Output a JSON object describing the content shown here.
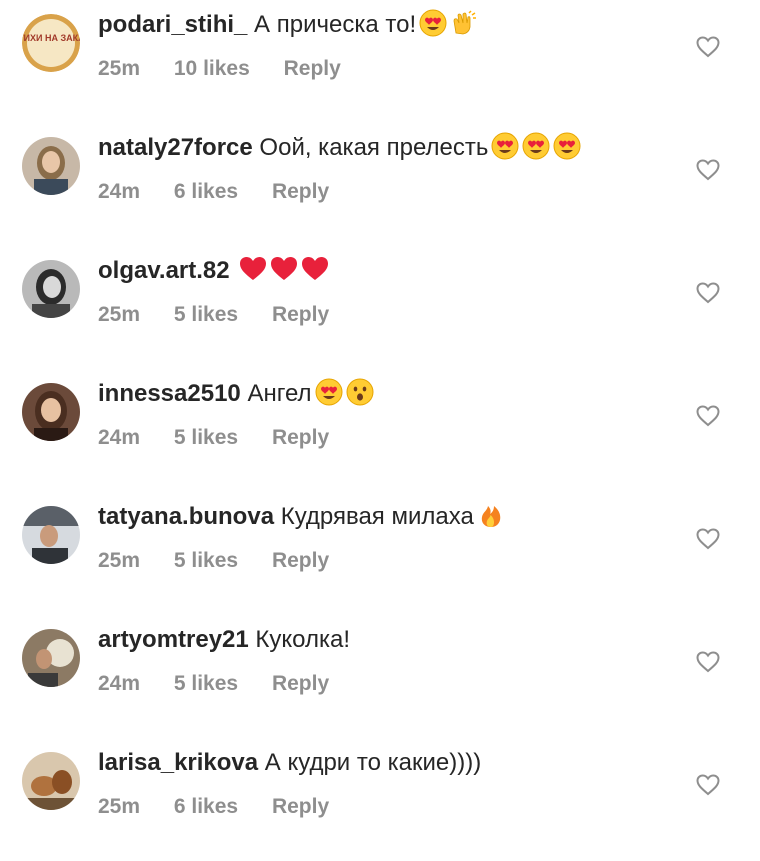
{
  "comments": [
    {
      "username": "podari_stihi_",
      "text": "А прическа то!",
      "emojis": [
        "heart-eyes-emoji",
        "clapping-hands-emoji"
      ],
      "time": "25m",
      "likes": "10 likes",
      "reply": "Reply",
      "avatar_label": "СТИХИ НА ЗАКАЗ"
    },
    {
      "username": "nataly27force",
      "text": "Оой, какая прелесть",
      "emojis": [
        "heart-eyes-emoji",
        "heart-eyes-emoji",
        "heart-eyes-emoji"
      ],
      "time": "24m",
      "likes": "6 likes",
      "reply": "Reply"
    },
    {
      "username": "olgav.art.82",
      "text": "",
      "emojis": [
        "red-heart-emoji",
        "red-heart-emoji",
        "red-heart-emoji"
      ],
      "time": "25m",
      "likes": "5 likes",
      "reply": "Reply"
    },
    {
      "username": "innessa2510",
      "text": "Ангел",
      "emojis": [
        "heart-eyes-emoji",
        "surprised-face-emoji"
      ],
      "time": "24m",
      "likes": "5 likes",
      "reply": "Reply"
    },
    {
      "username": "tatyana.bunova",
      "text": "Кудрявая милаха",
      "emojis": [
        "fire-emoji"
      ],
      "time": "25m",
      "likes": "5 likes",
      "reply": "Reply"
    },
    {
      "username": "artyomtrey21",
      "text": "Куколка!",
      "emojis": [],
      "time": "24m",
      "likes": "5 likes",
      "reply": "Reply"
    },
    {
      "username": "larisa_krikova",
      "text": "А кудри то какие))))",
      "emojis": [],
      "time": "25m",
      "likes": "6 likes",
      "reply": "Reply"
    }
  ],
  "colors": {
    "text": "#262626",
    "meta": "#8e8e8e",
    "heart_outline": "#8e8e8e",
    "background": "#ffffff"
  }
}
